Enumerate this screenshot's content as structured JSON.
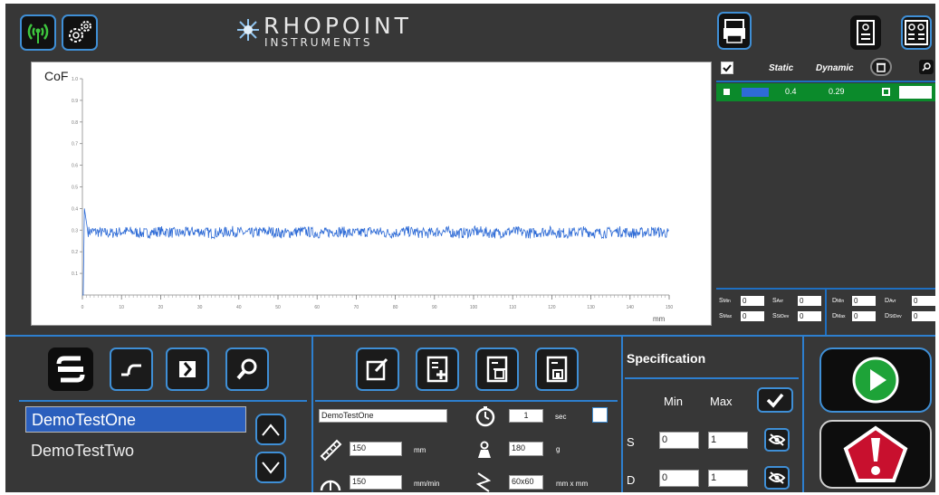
{
  "header": {
    "brand_name": "RHOPOINT",
    "brand_sub": "INSTRUMENTS",
    "icons": [
      "wireless-icon",
      "settings-gears-icon",
      "folder-print-icon",
      "report-single-icon",
      "report-multiple-icon"
    ]
  },
  "results": {
    "header": {
      "static": "Static",
      "dynamic": "Dynamic"
    },
    "row": {
      "static": "0.4",
      "dynamic": "0.29",
      "series_color": "#2e6bd6"
    }
  },
  "stats": {
    "s_min_label": "Min",
    "s_max_label": "Max",
    "s_avr_label": "Avr",
    "s_stdev_label": "StDev",
    "d_min_label": "Min",
    "d_max_label": "Max",
    "d_avr_label": "Avr",
    "d_stdev_label": "StDev",
    "s_min": "0",
    "s_max": "0",
    "s_avr": "0",
    "s_stdev": "0",
    "d_min": "0",
    "d_max": "0",
    "d_avr": "0",
    "d_stdev": "0",
    "s_letter": "S",
    "d_letter": "D"
  },
  "tests": {
    "items": [
      "DemoTestOne",
      "DemoTestTwo"
    ],
    "selected_index": 0
  },
  "params": {
    "name": "DemoTestOne",
    "time_value": "1",
    "time_unit": "sec",
    "distance_value": "150",
    "distance_unit": "mm",
    "speed_value": "150",
    "speed_unit": "mm/min",
    "mass_value": "180",
    "mass_unit": "g",
    "area_value": "60x60",
    "area_unit": "mm x mm"
  },
  "specification": {
    "title": "Specification",
    "min_label": "Min",
    "max_label": "Max",
    "s_label": "S",
    "d_label": "D",
    "s_min": "0",
    "s_max": "1",
    "d_min": "0",
    "d_max": "1"
  },
  "chart_data": {
    "type": "line",
    "title": "",
    "ylabel": "CoF",
    "xlabel": "mm",
    "xlim": [
      0,
      150
    ],
    "ylim": [
      0,
      1.0
    ],
    "x_ticks": [
      0,
      10,
      20,
      30,
      40,
      50,
      60,
      70,
      80,
      90,
      100,
      110,
      120,
      130,
      140,
      150
    ],
    "y_ticks": [
      0.1,
      0.2,
      0.3,
      0.4,
      0.5,
      0.6,
      0.7,
      0.8,
      0.9,
      1.0
    ],
    "y_tick_labels": [
      "0.1",
      "0.2",
      "0.3",
      "0.4",
      "0.5",
      "0.6",
      "0.7",
      "0.8",
      "0.9",
      "1.0"
    ],
    "series": [
      {
        "color": "#2e6bd6",
        "peak_x": 0.5,
        "peak_y": 0.4,
        "mean_y": 0.29,
        "band": 0.025,
        "x_end": 150
      }
    ],
    "grid": false
  }
}
